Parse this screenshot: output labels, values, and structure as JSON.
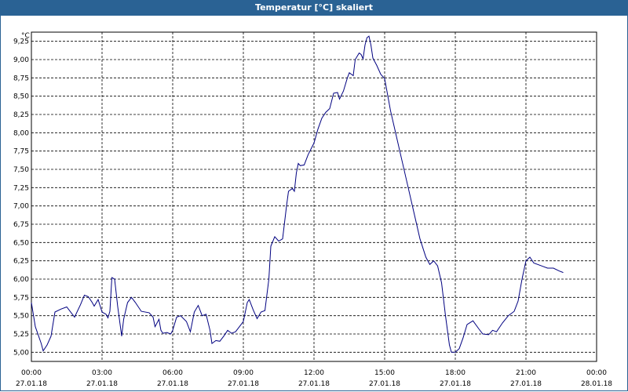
{
  "window": {
    "title": "Temperatur [°C] skaliert"
  },
  "chart_data": {
    "type": "line",
    "ylabel": "°C",
    "ylim": [
      4.875,
      9.375
    ],
    "yticks": [
      5.0,
      5.25,
      5.5,
      5.75,
      6.0,
      6.25,
      6.5,
      6.75,
      7.0,
      7.25,
      7.5,
      7.75,
      8.0,
      8.25,
      8.5,
      8.75,
      9.0,
      9.25
    ],
    "ytick_labels": [
      "5,00",
      "5,25",
      "5,50",
      "5,75",
      "6,00",
      "6,25",
      "6,50",
      "6,75",
      "7,00",
      "7,25",
      "7,50",
      "7,75",
      "8,00",
      "8,25",
      "8,50",
      "8,75",
      "9,00",
      "9,25"
    ],
    "xlim": [
      "27.01.18 00:00",
      "28.01.18 00:00"
    ],
    "xticks": [
      {
        "time": "00:00",
        "date": "27.01.18"
      },
      {
        "time": "03:00",
        "date": "27.01.18"
      },
      {
        "time": "06:00",
        "date": "27.01.18"
      },
      {
        "time": "09:00",
        "date": "27.01.18"
      },
      {
        "time": "12:00",
        "date": "27.01.18"
      },
      {
        "time": "15:00",
        "date": "27.01.18"
      },
      {
        "time": "18:00",
        "date": "27.01.18"
      },
      {
        "time": "21:00",
        "date": "27.01.18"
      },
      {
        "time": "00:00",
        "date": "28.01.18"
      }
    ],
    "grid": true,
    "series": [
      {
        "color": "#000080",
        "points": [
          {
            "x": "00:00",
            "y": 5.68
          },
          {
            "x": "00:10",
            "y": 5.35
          },
          {
            "x": "00:25",
            "y": 5.12
          },
          {
            "x": "00:30",
            "y": 5.02
          },
          {
            "x": "00:40",
            "y": 5.1
          },
          {
            "x": "00:50",
            "y": 5.22
          },
          {
            "x": "01:00",
            "y": 5.55
          },
          {
            "x": "01:15",
            "y": 5.59
          },
          {
            "x": "01:30",
            "y": 5.62
          },
          {
            "x": "01:50",
            "y": 5.48
          },
          {
            "x": "02:05",
            "y": 5.65
          },
          {
            "x": "02:15",
            "y": 5.78
          },
          {
            "x": "02:25",
            "y": 5.76
          },
          {
            "x": "02:35",
            "y": 5.68
          },
          {
            "x": "02:40",
            "y": 5.63
          },
          {
            "x": "02:50",
            "y": 5.72
          },
          {
            "x": "03:00",
            "y": 5.55
          },
          {
            "x": "03:10",
            "y": 5.52
          },
          {
            "x": "03:15",
            "y": 5.47
          },
          {
            "x": "03:20",
            "y": 5.56
          },
          {
            "x": "03:25",
            "y": 6.02
          },
          {
            "x": "03:32",
            "y": 6.0
          },
          {
            "x": "03:40",
            "y": 5.62
          },
          {
            "x": "03:50",
            "y": 5.22
          },
          {
            "x": "03:55",
            "y": 5.45
          },
          {
            "x": "04:05",
            "y": 5.68
          },
          {
            "x": "04:15",
            "y": 5.75
          },
          {
            "x": "04:25",
            "y": 5.68
          },
          {
            "x": "04:40",
            "y": 5.56
          },
          {
            "x": "05:00",
            "y": 5.54
          },
          {
            "x": "05:10",
            "y": 5.48
          },
          {
            "x": "05:15",
            "y": 5.35
          },
          {
            "x": "05:25",
            "y": 5.45
          },
          {
            "x": "05:30",
            "y": 5.3
          },
          {
            "x": "05:35",
            "y": 5.26
          },
          {
            "x": "05:45",
            "y": 5.27
          },
          {
            "x": "05:55",
            "y": 5.25
          },
          {
            "x": "06:00",
            "y": 5.3
          },
          {
            "x": "06:10",
            "y": 5.48
          },
          {
            "x": "06:20",
            "y": 5.5
          },
          {
            "x": "06:35",
            "y": 5.42
          },
          {
            "x": "06:45",
            "y": 5.28
          },
          {
            "x": "06:55",
            "y": 5.55
          },
          {
            "x": "07:05",
            "y": 5.64
          },
          {
            "x": "07:15",
            "y": 5.5
          },
          {
            "x": "07:25",
            "y": 5.52
          },
          {
            "x": "07:35",
            "y": 5.3
          },
          {
            "x": "07:40",
            "y": 5.12
          },
          {
            "x": "07:50",
            "y": 5.16
          },
          {
            "x": "08:00",
            "y": 5.15
          },
          {
            "x": "08:10",
            "y": 5.22
          },
          {
            "x": "08:20",
            "y": 5.3
          },
          {
            "x": "08:30",
            "y": 5.26
          },
          {
            "x": "08:40",
            "y": 5.28
          },
          {
            "x": "08:50",
            "y": 5.35
          },
          {
            "x": "09:00",
            "y": 5.42
          },
          {
            "x": "09:10",
            "y": 5.68
          },
          {
            "x": "09:15",
            "y": 5.72
          },
          {
            "x": "09:25",
            "y": 5.58
          },
          {
            "x": "09:35",
            "y": 5.46
          },
          {
            "x": "09:45",
            "y": 5.55
          },
          {
            "x": "09:55",
            "y": 5.57
          },
          {
            "x": "10:05",
            "y": 6.0
          },
          {
            "x": "10:10",
            "y": 6.45
          },
          {
            "x": "10:20",
            "y": 6.58
          },
          {
            "x": "10:30",
            "y": 6.52
          },
          {
            "x": "10:40",
            "y": 6.55
          },
          {
            "x": "10:50",
            "y": 7.0
          },
          {
            "x": "10:55",
            "y": 7.2
          },
          {
            "x": "11:05",
            "y": 7.24
          },
          {
            "x": "11:10",
            "y": 7.2
          },
          {
            "x": "11:15",
            "y": 7.45
          },
          {
            "x": "11:20",
            "y": 7.58
          },
          {
            "x": "11:25",
            "y": 7.55
          },
          {
            "x": "11:35",
            "y": 7.56
          },
          {
            "x": "11:45",
            "y": 7.7
          },
          {
            "x": "12:00",
            "y": 7.86
          },
          {
            "x": "12:10",
            "y": 8.05
          },
          {
            "x": "12:20",
            "y": 8.2
          },
          {
            "x": "12:30",
            "y": 8.28
          },
          {
            "x": "12:40",
            "y": 8.33
          },
          {
            "x": "12:50",
            "y": 8.54
          },
          {
            "x": "13:00",
            "y": 8.55
          },
          {
            "x": "13:05",
            "y": 8.46
          },
          {
            "x": "13:15",
            "y": 8.57
          },
          {
            "x": "13:25",
            "y": 8.75
          },
          {
            "x": "13:30",
            "y": 8.82
          },
          {
            "x": "13:40",
            "y": 8.78
          },
          {
            "x": "13:45",
            "y": 9.0
          },
          {
            "x": "13:55",
            "y": 9.09
          },
          {
            "x": "14:00",
            "y": 9.07
          },
          {
            "x": "14:05",
            "y": 9.01
          },
          {
            "x": "14:10",
            "y": 9.2
          },
          {
            "x": "14:15",
            "y": 9.3
          },
          {
            "x": "14:20",
            "y": 9.32
          },
          {
            "x": "14:25",
            "y": 9.2
          },
          {
            "x": "14:30",
            "y": 9.02
          },
          {
            "x": "14:40",
            "y": 8.92
          },
          {
            "x": "14:50",
            "y": 8.8
          },
          {
            "x": "15:00",
            "y": 8.74
          },
          {
            "x": "15:15",
            "y": 8.3
          },
          {
            "x": "15:30",
            "y": 7.95
          },
          {
            "x": "15:45",
            "y": 7.6
          },
          {
            "x": "16:00",
            "y": 7.25
          },
          {
            "x": "16:15",
            "y": 6.9
          },
          {
            "x": "16:30",
            "y": 6.55
          },
          {
            "x": "16:45",
            "y": 6.3
          },
          {
            "x": "16:55",
            "y": 6.2
          },
          {
            "x": "17:05",
            "y": 6.25
          },
          {
            "x": "17:15",
            "y": 6.18
          },
          {
            "x": "17:25",
            "y": 5.95
          },
          {
            "x": "17:35",
            "y": 5.5
          },
          {
            "x": "17:45",
            "y": 5.1
          },
          {
            "x": "17:50",
            "y": 5.0
          },
          {
            "x": "18:00",
            "y": 5.0
          },
          {
            "x": "18:10",
            "y": 5.05
          },
          {
            "x": "18:20",
            "y": 5.2
          },
          {
            "x": "18:30",
            "y": 5.38
          },
          {
            "x": "18:45",
            "y": 5.43
          },
          {
            "x": "19:00",
            "y": 5.32
          },
          {
            "x": "19:10",
            "y": 5.25
          },
          {
            "x": "19:25",
            "y": 5.24
          },
          {
            "x": "19:35",
            "y": 5.3
          },
          {
            "x": "19:45",
            "y": 5.28
          },
          {
            "x": "20:00",
            "y": 5.4
          },
          {
            "x": "20:15",
            "y": 5.5
          },
          {
            "x": "20:30",
            "y": 5.56
          },
          {
            "x": "20:40",
            "y": 5.7
          },
          {
            "x": "20:50",
            "y": 6.0
          },
          {
            "x": "21:00",
            "y": 6.25
          },
          {
            "x": "21:10",
            "y": 6.3
          },
          {
            "x": "21:20",
            "y": 6.22
          },
          {
            "x": "21:40",
            "y": 6.18
          },
          {
            "x": "21:55",
            "y": 6.15
          },
          {
            "x": "22:10",
            "y": 6.15
          },
          {
            "x": "22:25",
            "y": 6.11
          },
          {
            "x": "22:35",
            "y": 6.09
          }
        ]
      }
    ]
  }
}
